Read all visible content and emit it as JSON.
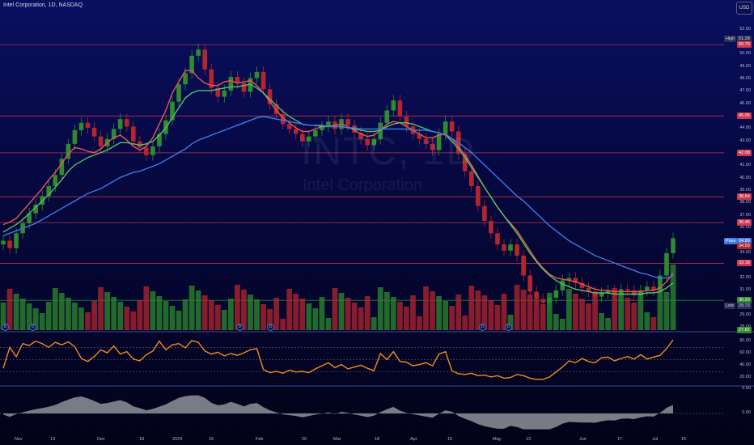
{
  "header": {
    "title": "Intel Corporation, 1D, NASDAQ",
    "currency": "USD"
  },
  "watermark": {
    "ticker": "INTC, 1D",
    "company": "Intel Corporation"
  },
  "colors": {
    "up": "#2e8b2e",
    "down": "#b3262d",
    "ema_fast": "#e8584f",
    "ema_mid": "#58c06a",
    "ema_slow": "#3c7be6",
    "rsi": "#f4881f",
    "hline": "#d0364c",
    "macd_area": "#a0a4a8"
  },
  "price_axis": [
    "52.00",
    "51.00",
    "50.00",
    "49.00",
    "48.00",
    "47.00",
    "46.00",
    "45.00",
    "44.00",
    "43.00",
    "42.00",
    "41.00",
    "40.00",
    "39.00",
    "38.00",
    "37.00",
    "36.00",
    "35.00",
    "34.00",
    "33.00",
    "32.00",
    "31.00",
    "30.00",
    "29.00",
    "28.00"
  ],
  "price_badges": [
    {
      "label": "High",
      "value": "51.28",
      "color": "#2a2f56",
      "text": "#d6d8e6"
    },
    {
      "value": "50.79",
      "color": "#d0364c"
    },
    {
      "value": "45.05",
      "color": "#d0364c"
    },
    {
      "value": "42.08",
      "color": "#d0364c"
    },
    {
      "value": "38.54",
      "color": "#d0364c"
    },
    {
      "value": "36.46",
      "color": "#d0364c"
    },
    {
      "label": "Pass",
      "value": "34.99",
      "color": "#3c7be6"
    },
    {
      "value": "34.59",
      "color": "#b3262d"
    },
    {
      "value": "33.18",
      "color": "#d0364c"
    },
    {
      "value": "30.20",
      "color": "#2e8b2e"
    },
    {
      "label": "Low",
      "value": "29.73",
      "color": "#2a2f56",
      "text": "#d6d8e6"
    },
    {
      "value": "27.82",
      "color": "#2e8b2e"
    }
  ],
  "rsi_axis": [
    "80.00",
    "60.00",
    "40.00",
    "20.00"
  ],
  "macd_axis": [
    "0.50",
    "0.00"
  ],
  "time_axis": [
    "Nov",
    "13",
    "Dec",
    "18",
    "2024",
    "16",
    "Feb",
    "20",
    "Mar",
    "18",
    "Apr",
    "15",
    "May",
    "13",
    "Jun",
    "17",
    "Jul",
    "15"
  ],
  "event_markers": [
    "D",
    "D",
    "D",
    "D",
    "D",
    "D"
  ],
  "chart_data": {
    "type": "line",
    "title": "Intel Corporation, 1D, NASDAQ",
    "ylim": [
      27.8,
      52.5
    ],
    "series": [
      {
        "values": [
          35.0,
          34.4,
          35.6,
          36.4,
          37.2,
          37.9,
          38.6,
          39.4,
          40.3,
          41.6,
          42.8,
          43.9,
          44.5,
          44.1,
          43.4,
          42.6,
          43.2,
          44.0,
          44.8,
          44.2,
          43.0,
          42.5,
          41.9,
          42.6,
          43.6,
          44.7,
          46.2,
          47.6,
          48.5,
          49.9,
          50.4,
          48.8,
          47.3,
          46.6,
          47.1,
          48.2,
          47.7,
          47.0,
          48.1,
          48.6,
          47.2,
          46.0,
          45.2,
          44.4,
          44.0,
          43.6,
          43.0,
          43.4,
          43.9,
          44.2,
          44.6,
          44.0,
          44.8,
          44.3,
          43.7,
          43.2,
          42.7,
          43.2,
          44.5,
          45.5,
          46.3,
          45.0,
          44.2,
          43.6,
          43.2,
          42.8,
          42.3,
          43.6,
          44.6,
          43.8,
          42.0,
          40.6,
          39.4,
          37.8,
          36.6,
          35.6,
          34.7,
          34.2,
          34.7,
          33.8,
          32.2,
          30.9,
          30.3,
          30.0,
          30.4,
          31.0,
          31.8,
          32.0,
          31.6,
          31.2,
          30.9,
          30.5,
          30.8,
          31.0,
          30.7,
          31.1,
          31.0,
          30.6,
          31.0,
          31.3,
          31.0,
          32.2,
          34.0,
          35.2
        ]
      },
      {
        "values": [
          36.3,
          36.5,
          36.8,
          37.4,
          38.0,
          38.6,
          39.2,
          39.9,
          40.5,
          41.2,
          42.0,
          42.5,
          42.4,
          42.2,
          42.1,
          42.4,
          42.9,
          43.3,
          43.5,
          43.1,
          42.6,
          42.3,
          42.6,
          43.3,
          44.4,
          45.5,
          46.9,
          47.8,
          48.7,
          48.7,
          48.1,
          47.7,
          47.5,
          47.5,
          47.8,
          47.9,
          47.7,
          47.8,
          47.9,
          47.5,
          46.9,
          46.2,
          45.5,
          44.9,
          44.5,
          44.1,
          43.8,
          43.8,
          44.0,
          44.2,
          44.2,
          44.3,
          44.4,
          44.2,
          43.9,
          43.6,
          43.4,
          43.5,
          43.9,
          44.4,
          44.6,
          44.5,
          44.2,
          43.9,
          43.6,
          43.3,
          43.3,
          43.5,
          43.6,
          43.2,
          42.6,
          41.9,
          41.1,
          40.2,
          39.3,
          38.5,
          37.7,
          37.0,
          36.4,
          35.8,
          35.0,
          34.2,
          33.4,
          32.8,
          32.3,
          32.0,
          31.9,
          31.8,
          31.7,
          31.5,
          31.3,
          31.1,
          31.0,
          31.0,
          30.9,
          30.9,
          30.9,
          30.9,
          30.9,
          31.0,
          31.0,
          31.2,
          31.7,
          32.4
        ]
      },
      {
        "values": [
          35.7,
          36.0,
          36.3,
          36.7,
          37.2,
          37.7,
          38.2,
          38.7,
          39.3,
          39.9,
          40.6,
          41.1,
          41.4,
          41.7,
          41.9,
          42.1,
          42.3,
          42.6,
          42.9,
          42.9,
          42.8,
          42.7,
          42.8,
          43.0,
          43.5,
          44.1,
          44.9,
          45.7,
          46.5,
          46.9,
          47.1,
          47.1,
          47.1,
          47.2,
          47.3,
          47.4,
          47.4,
          47.5,
          47.6,
          47.3,
          46.9,
          46.4,
          45.9,
          45.4,
          45.0,
          44.7,
          44.4,
          44.3,
          44.3,
          44.2,
          44.2,
          44.2,
          44.2,
          44.1,
          44.0,
          43.9,
          43.8,
          43.8,
          43.9,
          44.2,
          44.4,
          44.5,
          44.5,
          44.4,
          44.2,
          44.0,
          43.8,
          43.7,
          43.5,
          43.0,
          42.4,
          41.7,
          40.9,
          40.1,
          39.3,
          38.5,
          37.7,
          37.0,
          36.3,
          35.6,
          34.8,
          34.0,
          33.3,
          32.7,
          32.2,
          31.8,
          31.5,
          31.3,
          31.1,
          31.0,
          30.9,
          30.8,
          30.8,
          30.8,
          30.7,
          30.7,
          30.7,
          30.7,
          30.7,
          30.8,
          30.8,
          30.9,
          31.2,
          31.6
        ]
      },
      {
        "values": [
          35.4,
          35.6,
          35.8,
          36.0,
          36.2,
          36.4,
          36.7,
          37.0,
          37.3,
          37.6,
          37.9,
          38.2,
          38.5,
          38.8,
          39.0,
          39.2,
          39.5,
          39.8,
          40.1,
          40.3,
          40.5,
          40.6,
          40.8,
          41.0,
          41.2,
          41.5,
          41.8,
          42.1,
          42.4,
          42.8,
          43.1,
          43.3,
          43.5,
          43.7,
          43.9,
          44.1,
          44.3,
          44.5,
          44.7,
          44.9,
          45.0,
          44.9,
          44.8,
          44.7,
          44.6,
          44.5,
          44.4,
          44.3,
          44.3,
          44.3,
          44.2,
          44.2,
          44.2,
          44.1,
          44.1,
          44.0,
          44.0,
          44.0,
          44.0,
          44.0,
          44.0,
          44.0,
          44.0,
          43.9,
          43.9,
          43.9,
          43.8,
          43.7,
          43.5,
          43.2,
          42.9,
          42.5,
          42.1,
          41.6,
          41.1,
          40.6,
          40.1,
          39.6,
          39.1,
          38.6,
          38.2,
          37.7,
          37.2,
          36.7,
          36.2,
          35.8,
          35.4,
          35.0,
          34.7,
          34.4,
          34.1,
          33.8,
          33.6,
          33.4,
          33.2,
          33.0,
          32.8,
          32.6,
          32.4,
          32.3,
          32.1,
          32.0,
          32.0,
          32.2
        ]
      },
      {
        "values": [
          36,
          70,
          55,
          76,
          73,
          80,
          76,
          70,
          78,
          74,
          79,
          71,
          52,
          47,
          55,
          66,
          61,
          72,
          59,
          63,
          51,
          48,
          58,
          64,
          80,
          66,
          74,
          76,
          69,
          81,
          78,
          64,
          59,
          62,
          56,
          60,
          57,
          61,
          66,
          68,
          34,
          29,
          31,
          28,
          33,
          30,
          31,
          29,
          35,
          40,
          45,
          37,
          42,
          35,
          38,
          41,
          36,
          32,
          60,
          50,
          63,
          47,
          46,
          40,
          42,
          45,
          40,
          59,
          63,
          32,
          27,
          26,
          28,
          24,
          25,
          22,
          24,
          20,
          21,
          26,
          24,
          20,
          18,
          18,
          22,
          30,
          38,
          48,
          45,
          52,
          47,
          45,
          53,
          54,
          48,
          52,
          55,
          51,
          58,
          51,
          54,
          57,
          68,
          82
        ]
      }
    ]
  }
}
